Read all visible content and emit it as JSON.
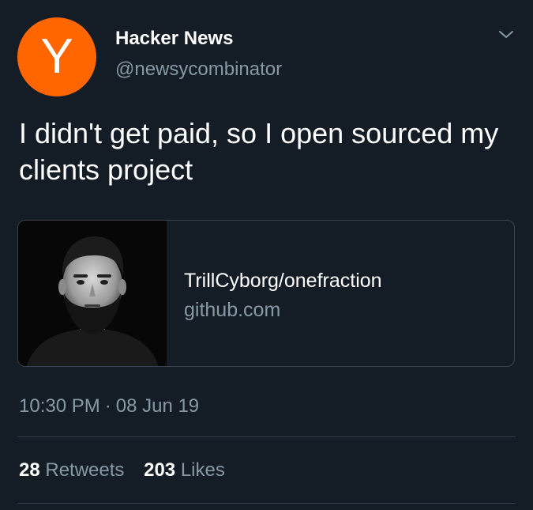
{
  "tweet": {
    "avatar": {
      "letter": "Y",
      "color": "#ff6600",
      "icon": "ycombinator-logo-icon"
    },
    "display_name": "Hacker News",
    "handle": "@newsycombinator",
    "menu_icon": "chevron-down-icon",
    "text": "I didn't get paid, so I open sourced my clients project",
    "link_card": {
      "title": "TrillCyborg/onefraction",
      "domain": "github.com",
      "thumbnail": "bearded-man-portrait"
    },
    "time": "10:30 PM",
    "separator": "·",
    "date": "08 Jun 19",
    "stats": {
      "retweets_count": "28",
      "retweets_label": "Retweets",
      "likes_count": "203",
      "likes_label": "Likes"
    }
  },
  "colors": {
    "background": "#141d26",
    "primary_text": "#ffffff",
    "secondary_text": "#8899a6",
    "divider": "#2f3d4a",
    "brand_orange": "#ff6600"
  }
}
